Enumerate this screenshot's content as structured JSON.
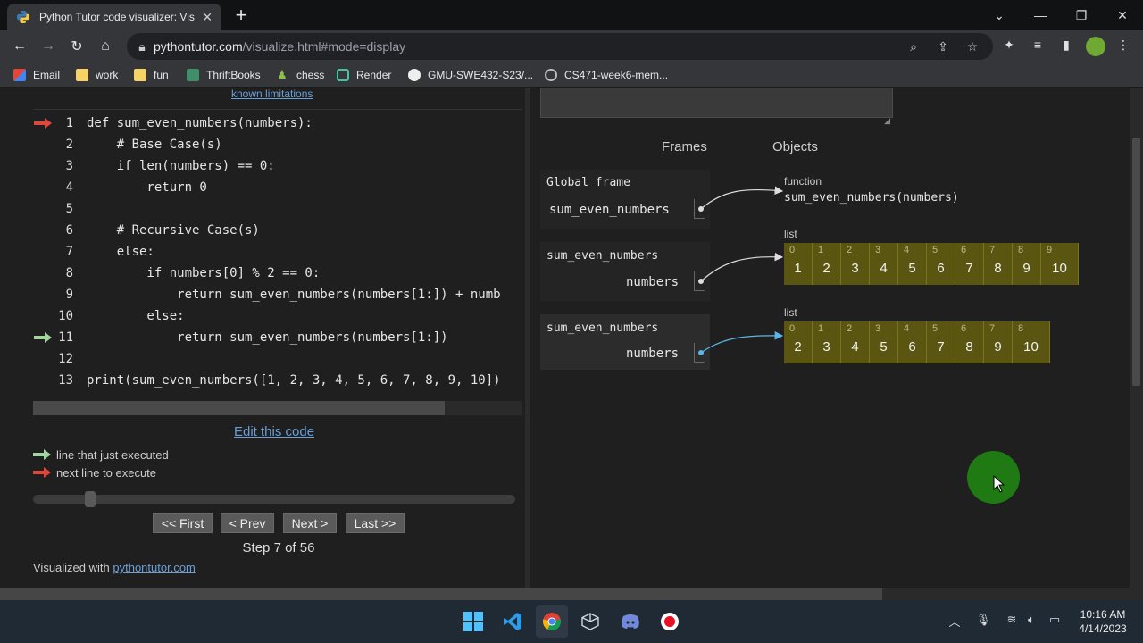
{
  "browser": {
    "tab_title": "Python Tutor code visualizer: Visu",
    "url_host": "pythontutor.com",
    "url_path": "/visualize.html#mode=display",
    "bookmarks": [
      "Email",
      "work",
      "fun",
      "ThriftBooks",
      "chess",
      "Render",
      "GMU-SWE432-S23/...",
      "CS471-week6-mem..."
    ]
  },
  "code": {
    "known_limitations": "known limitations",
    "lines": [
      {
        "n": "1",
        "text": "def sum_even_numbers(numbers):",
        "arrow": "next"
      },
      {
        "n": "2",
        "text": "    # Base Case(s)",
        "arrow": ""
      },
      {
        "n": "3",
        "text": "    if len(numbers) == 0:",
        "arrow": ""
      },
      {
        "n": "4",
        "text": "        return 0",
        "arrow": ""
      },
      {
        "n": "5",
        "text": "",
        "arrow": ""
      },
      {
        "n": "6",
        "text": "    # Recursive Case(s)",
        "arrow": ""
      },
      {
        "n": "7",
        "text": "    else:",
        "arrow": ""
      },
      {
        "n": "8",
        "text": "        if numbers[0] % 2 == 0:",
        "arrow": ""
      },
      {
        "n": "9",
        "text": "            return sum_even_numbers(numbers[1:]) + numb",
        "arrow": ""
      },
      {
        "n": "10",
        "text": "        else:",
        "arrow": ""
      },
      {
        "n": "11",
        "text": "            return sum_even_numbers(numbers[1:])",
        "arrow": "executed"
      },
      {
        "n": "12",
        "text": "",
        "arrow": ""
      },
      {
        "n": "13",
        "text": "print(sum_even_numbers([1, 2, 3, 4, 5, 6, 7, 8, 9, 10])",
        "arrow": ""
      }
    ],
    "edit_link": "Edit this code",
    "legend_executed": "line that just executed",
    "legend_next": "next line to execute",
    "buttons": {
      "first": "<< First",
      "prev": "< Prev",
      "next": "Next >",
      "last": "Last >>"
    },
    "step_text": "Step 7 of 56",
    "visualized_prefix": "Visualized with ",
    "visualized_link": "pythontutor.com",
    "step_current": 7,
    "step_total": 56
  },
  "viz": {
    "frames_header": "Frames",
    "objects_header": "Objects",
    "frames": [
      {
        "title": "Global frame",
        "var": "sum_even_numbers"
      },
      {
        "title": "sum_even_numbers",
        "var": "numbers"
      },
      {
        "title": "sum_even_numbers",
        "var": "numbers"
      }
    ],
    "function_label": "function",
    "function_name": "sum_even_numbers(numbers)",
    "list_label": "list",
    "list1": [
      "1",
      "2",
      "3",
      "4",
      "5",
      "6",
      "7",
      "8",
      "9",
      "10"
    ],
    "list2": [
      "2",
      "3",
      "4",
      "5",
      "6",
      "7",
      "8",
      "9",
      "10"
    ]
  },
  "taskbar": {
    "time": "10:16 AM",
    "date": "4/14/2023"
  },
  "colors": {
    "next_arrow": "#e0463a",
    "executed_arrow": "#a2d5a0",
    "list_bg": "#5a5510",
    "active_pointer": "#5ab6e8"
  }
}
